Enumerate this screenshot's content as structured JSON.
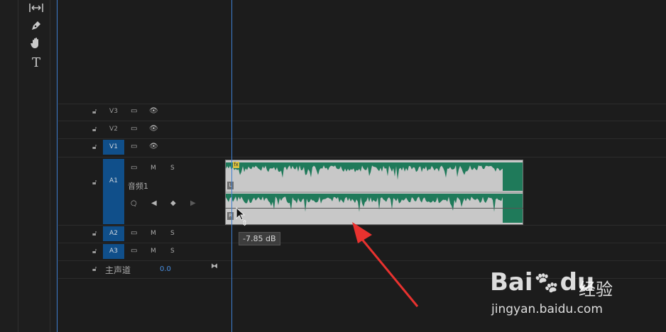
{
  "toolbar": {
    "tools": [
      {
        "icon": "track-select-icon",
        "glyph": "|↔|"
      },
      {
        "icon": "pen-icon",
        "glyph": "✒"
      },
      {
        "icon": "hand-icon",
        "glyph": "✋"
      },
      {
        "icon": "type-icon",
        "glyph": "T"
      }
    ]
  },
  "tracks": {
    "v3": {
      "label": "V3"
    },
    "v2": {
      "label": "V2"
    },
    "v1": {
      "label": "V1"
    },
    "a1": {
      "label": "A1",
      "name": "音频1"
    },
    "a2": {
      "label": "A2"
    },
    "a3": {
      "label": "A3"
    },
    "master": {
      "label": "主声道",
      "value": "0.0"
    }
  },
  "buttons": {
    "mute": "M",
    "solo": "S"
  },
  "clip": {
    "fx": "fx",
    "left_channel": "L",
    "right_channel": "R",
    "volume_tooltip": "-7.85 dB"
  },
  "watermark": {
    "brand": "Bai",
    "brand2": "du",
    "cn": "经验",
    "url": "jingyan.baidu.com"
  },
  "colors": {
    "accent": "#104f8a",
    "waveform": "#1f7a5a",
    "arrow": "#e8322f",
    "playhead": "#3f7fd0"
  }
}
